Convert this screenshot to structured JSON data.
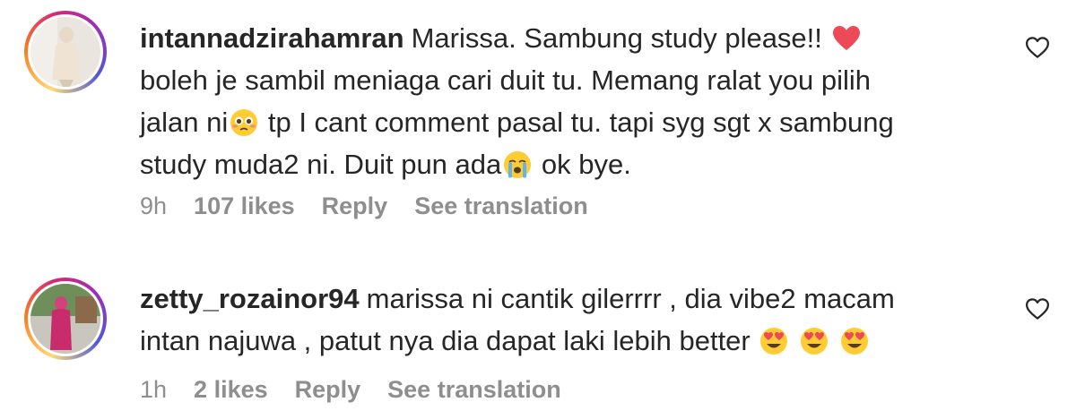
{
  "comments": [
    {
      "username": "intannadzirahamran",
      "line1_text": "Marissa. Sambung study please!!",
      "line1_emoji": "red-heart-icon",
      "line2_text": "boleh je sambil meniaga cari duit tu. Memang ralat you pilih",
      "line3_pre": "jalan ni",
      "line3_emoji": "flushed-pleading-face-icon",
      "line3_post": " tp I cant comment pasal tu. tapi syg sgt x sambung",
      "line4_pre": "study muda2 ni. Duit pun ada",
      "line4_emoji": "loudly-crying-face-icon",
      "line4_post": " ok bye.",
      "time": "9h",
      "likes": "107 likes",
      "reply_label": "Reply",
      "translate_label": "See translation",
      "like_icon": "heart-outline-icon"
    },
    {
      "username": "zetty_rozainor94",
      "line1_text": "marissa ni cantik gilerrrr , dia vibe2 macam",
      "line2_text": "intan najuwa , patut nya dia dapat laki lebih better",
      "line2_emojis": [
        "smiling-face-with-heart-eyes-icon",
        "smiling-face-with-heart-eyes-icon",
        "smiling-face-with-heart-eyes-icon"
      ],
      "time": "1h",
      "likes": "2 likes",
      "reply_label": "Reply",
      "translate_label": "See translation",
      "like_icon": "heart-outline-icon"
    }
  ],
  "colors": {
    "text": "#262626",
    "meta": "#8e8e8e",
    "heart": "#ed4956",
    "emoji_yellow": "#ffcc33"
  }
}
